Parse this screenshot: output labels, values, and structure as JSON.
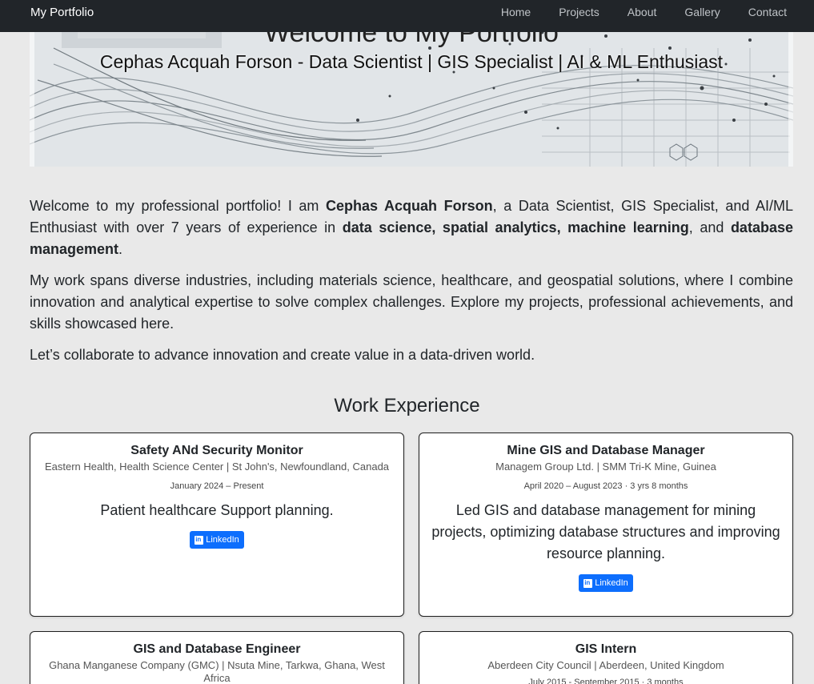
{
  "navbar": {
    "brand": "My Portfolio",
    "links": [
      "Home",
      "Projects",
      "About",
      "Gallery",
      "Contact"
    ]
  },
  "hero": {
    "title": "Welcome to My Portfolio",
    "subtitle": "Cephas Acquah Forson - Data Scientist | GIS Specialist | AI & ML Enthusiast"
  },
  "intro": {
    "p1_a": "Welcome to my professional portfolio! I am ",
    "p1_name": "Cephas Acquah Forson",
    "p1_b": ", a Data Scientist, GIS Specialist, and AI/ML Enthusiast with over 7 years of experience in ",
    "p1_skills": "data science, spatial analytics, machine learning",
    "p1_c": ", and ",
    "p1_db": "database management",
    "p1_d": ".",
    "p2": "My work spans diverse industries, including materials science, healthcare, and geospatial solutions, where I combine innovation and analytical expertise to solve complex challenges. Explore my projects, professional achievements, and skills showcased here.",
    "p3": "Let’s collaborate to advance innovation and create value in a data-driven world."
  },
  "work": {
    "title": "Work Experience",
    "jobs": [
      {
        "title": "Safety ANd Security Monitor",
        "org": "Eastern Health, Health Science Center | St John's, Newfoundland, Canada",
        "date": "January 2024 – Present",
        "desc": "Patient healthcare Support planning.",
        "button": "LinkedIn"
      },
      {
        "title": "Mine GIS and Database Manager",
        "org": "Managem Group Ltd. | SMM Tri-K Mine, Guinea",
        "date": "April 2020 – August 2023 · 3 yrs 8 months",
        "desc": "Led GIS and database management for mining projects, optimizing database structures and improving resource planning.",
        "button": "LinkedIn"
      },
      {
        "title": "GIS and Database Engineer",
        "org": "Ghana Manganese Company (GMC) | Nsuta Mine, Tarkwa, Ghana, West Africa",
        "date": "",
        "desc": "",
        "button": ""
      },
      {
        "title": "GIS Intern",
        "org": "Aberdeen City Council | Aberdeen, United Kingdom",
        "date": "July 2015 - September 2015 · 3 months",
        "desc": "",
        "button": ""
      }
    ]
  },
  "colors": {
    "navbar": "#212529",
    "accent": "#0d6efd",
    "background": "#e9e9e9"
  }
}
